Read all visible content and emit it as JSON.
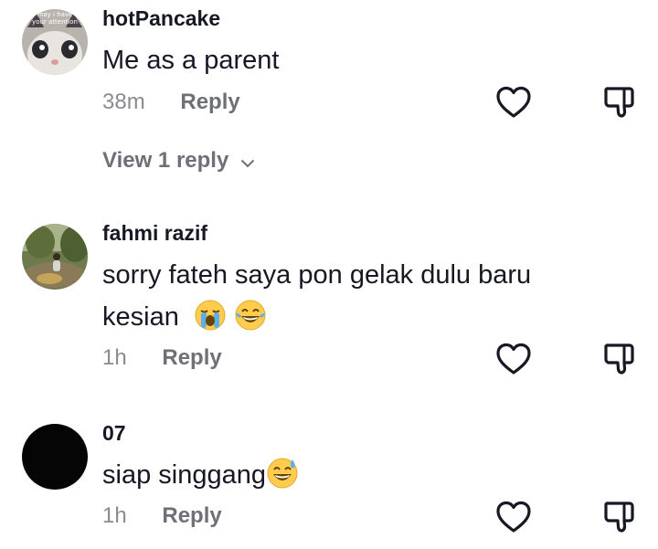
{
  "comments": [
    {
      "username": "hotPancake",
      "text": "Me as a parent",
      "time": "38m",
      "reply_label": "Reply",
      "avatar_caption_line1": "may i have",
      "avatar_caption_line2": "your attention",
      "view_replies_label": "View 1 reply"
    },
    {
      "username": "fahmi razif",
      "text_line1": "sorry fateh saya pon gelak dulu baru",
      "text_line2": "kesian",
      "time": "1h",
      "reply_label": "Reply",
      "emojis": [
        "loudly-crying-face-emoji",
        "tears-of-joy-emoji"
      ]
    },
    {
      "username": "07",
      "text": "siap singgang",
      "time": "1h",
      "reply_label": "Reply",
      "emojis": [
        "grinning-sweat-emoji"
      ]
    }
  ],
  "colors": {
    "text": "#161823",
    "secondary": "#8a8b91",
    "reply": "#6f7077",
    "icon": "#161823"
  },
  "icons": [
    "heart-outline-icon",
    "thumbs-down-outline-icon",
    "chevron-down-icon"
  ]
}
